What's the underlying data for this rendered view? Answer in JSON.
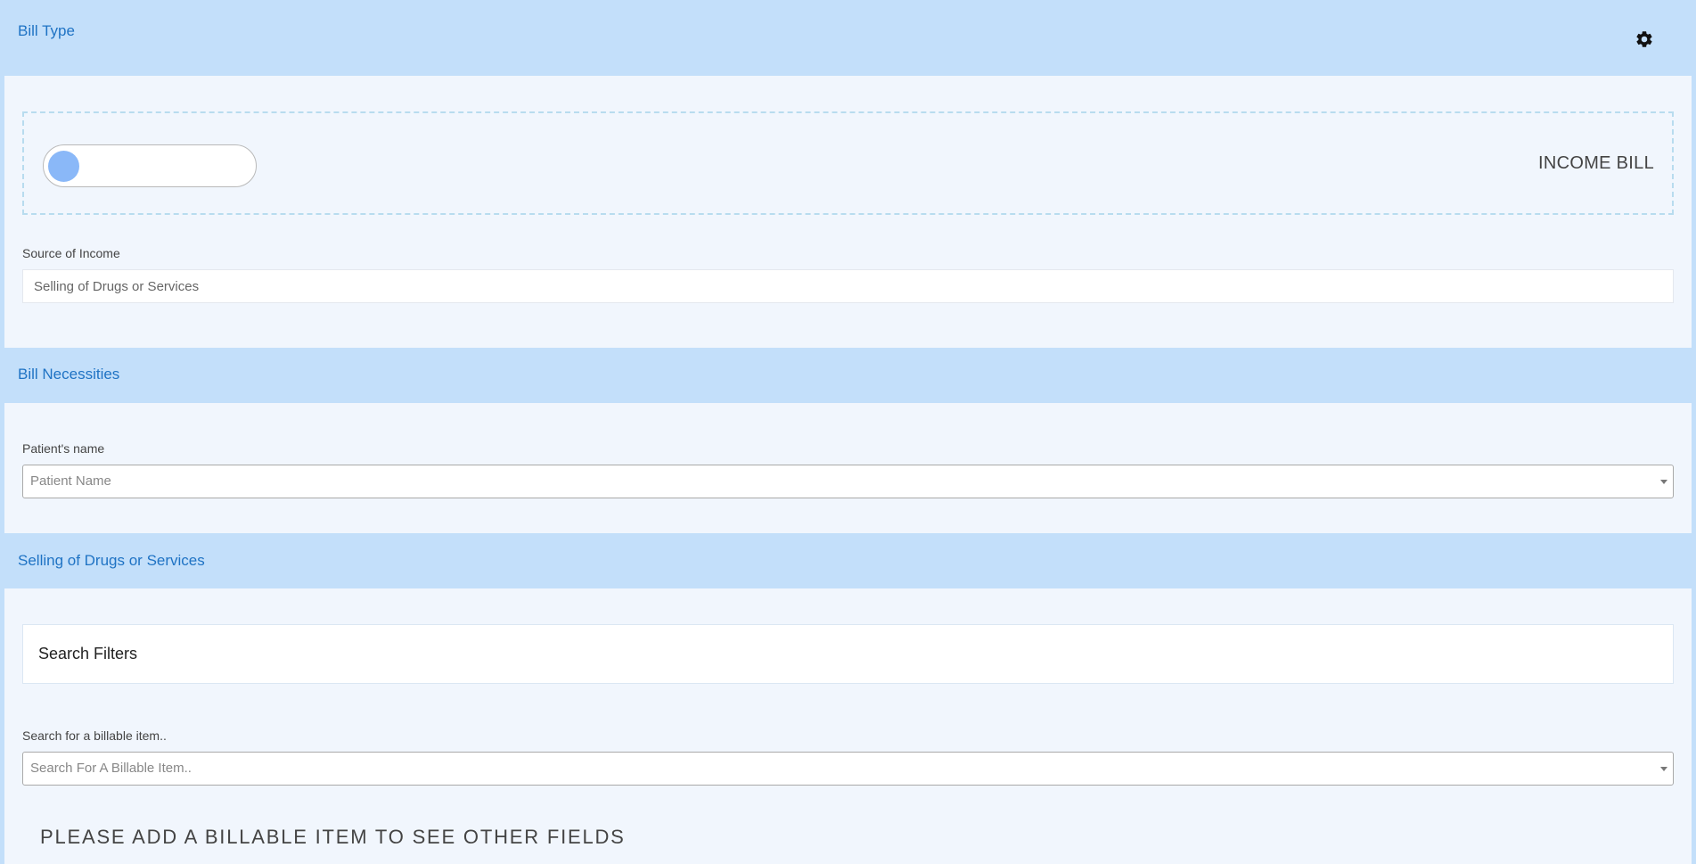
{
  "sections": {
    "bill_type": {
      "title": "Bill Type",
      "settings_icon": "gear-icon",
      "toggle_label": "INCOME BILL",
      "source_label": "Source of Income",
      "source_value": "Selling of Drugs or Services"
    },
    "bill_necessities": {
      "title": "Bill Necessities",
      "patient_label": "Patient's name",
      "patient_placeholder": "Patient Name"
    },
    "selling": {
      "title": "Selling of Drugs or Services",
      "search_filters_title": "Search Filters",
      "billable_label": "Search for a billable item..",
      "billable_placeholder": "Search For A Billable Item..",
      "notice": "PLEASE ADD A BILLABLE ITEM TO SEE OTHER FIELDS"
    }
  },
  "colors": {
    "header_bg": "#c3dffa",
    "header_text": "#1f73c4",
    "page_bg": "#f1f6fd",
    "toggle_knob": "#8ab8f8",
    "dashed_border": "#b8dcef"
  }
}
